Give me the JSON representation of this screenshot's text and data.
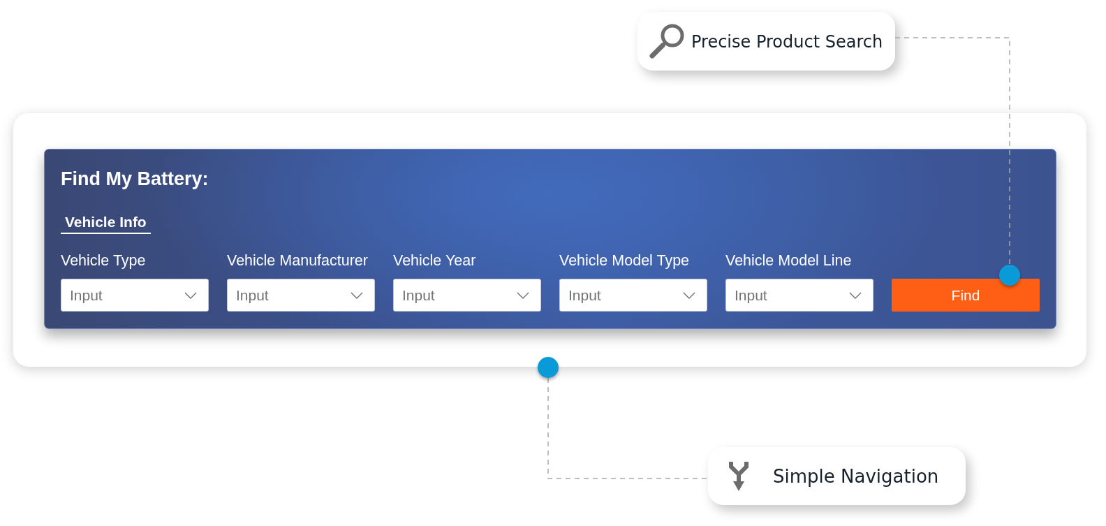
{
  "callouts": [
    {
      "kind": "search",
      "label": "Precise Product Search"
    },
    {
      "kind": "branch",
      "label": "Simple Navigation"
    }
  ],
  "finder": {
    "title": "Find My Battery:",
    "tabs": [
      {
        "label": "Vehicle Info",
        "selected": true
      }
    ],
    "fields": [
      {
        "label": "Vehicle Type",
        "placeholder": "Input"
      },
      {
        "label": "Vehicle Manufacturer",
        "placeholder": "Input"
      },
      {
        "label": "Vehicle Year",
        "placeholder": "Input"
      },
      {
        "label": "Vehicle Model Type",
        "placeholder": "Input"
      },
      {
        "label": "Vehicle Model Line",
        "placeholder": "Input"
      }
    ],
    "button": "Find"
  }
}
